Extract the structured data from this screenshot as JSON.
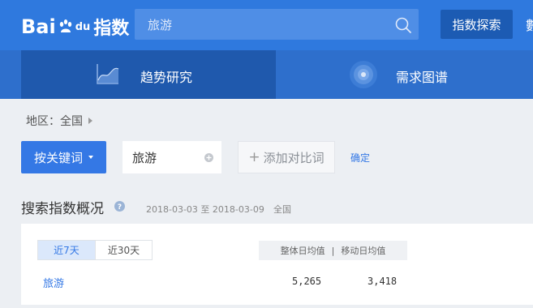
{
  "header": {
    "logo_main": "Bai",
    "logo_tail": "du",
    "logo_product": "指数",
    "search_value": "旅游",
    "explore_label": "指数探索",
    "cut_text": "數"
  },
  "nav": {
    "tabs": [
      {
        "label": "趋势研究",
        "icon": "trend-chart-icon",
        "active": true
      },
      {
        "label": "需求图谱",
        "icon": "target-icon",
        "active": false
      }
    ]
  },
  "region": {
    "label": "地区：全国"
  },
  "keyword_bar": {
    "keyword_button_label": "按关键词",
    "keyword_value": "旅游",
    "add_compare_label": "添加对比词",
    "confirm_label": "确定"
  },
  "overview": {
    "title": "搜索指数概况",
    "date_range": "2018-03-03 至 2018-03-09",
    "region": "全国",
    "range_tabs": [
      {
        "label": "近7天",
        "selected": true
      },
      {
        "label": "近30天",
        "selected": false
      }
    ],
    "column_overall": "整体日均值",
    "column_separator": "|",
    "column_mobile": "移动日均值",
    "rows": [
      {
        "keyword": "旅游",
        "overall": "5,265",
        "mobile": "3,418"
      }
    ]
  },
  "colors": {
    "header_bg": "#2f79de",
    "nav_bg": "#2e6fcc",
    "nav_active_bg": "#1f59ad",
    "primary": "#3478e5",
    "page_bg": "#eceff3"
  }
}
